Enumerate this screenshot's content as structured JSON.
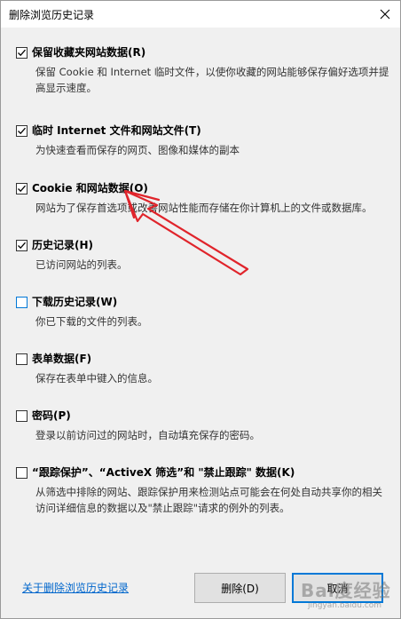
{
  "dialog": {
    "title": "删除浏览历史记录",
    "close_icon": "close-icon"
  },
  "options": [
    {
      "label": "保留收藏夹网站数据(R)",
      "description": "保留 Cookie 和 Internet 临时文件，以使你收藏的网站能够保存偏好选项并提高显示速度。",
      "checked": true
    },
    {
      "label": "临时 Internet 文件和网站文件(T)",
      "description": "为快速查看而保存的网页、图像和媒体的副本",
      "checked": true
    },
    {
      "label": "Cookie 和网站数据(O)",
      "description": "网站为了保存首选项或改善网站性能而存储在你计算机上的文件或数据库。",
      "checked": true
    },
    {
      "label": "历史记录(H)",
      "description": "已访问网站的列表。",
      "checked": true
    },
    {
      "label": "下载历史记录(W)",
      "description": "你已下载的文件的列表。",
      "checked": false
    },
    {
      "label": "表单数据(F)",
      "description": "保存在表单中键入的信息。",
      "checked": false
    },
    {
      "label": "密码(P)",
      "description": "登录以前访问过的网站时，自动填充保存的密码。",
      "checked": false
    },
    {
      "label": "“跟踪保护”、“ActiveX 筛选”和 \"禁止跟踪\" 数据(K)",
      "description": "从筛选中排除的网站、跟踪保护用来检测站点可能会在何处自动共享你的相关访问详细信息的数据以及\"禁止跟踪\"请求的例外的列表。",
      "checked": false
    }
  ],
  "footer": {
    "about_link": "关于删除浏览历史记录",
    "delete_button": "删除(D)",
    "cancel_button": "取消"
  },
  "watermark": {
    "text": "Bai度经验",
    "sub": "jingyan.baidu.com"
  },
  "colors": {
    "link": "#0066cc",
    "focus_border": "#0078d7",
    "annotation_arrow": "#e0242b"
  }
}
